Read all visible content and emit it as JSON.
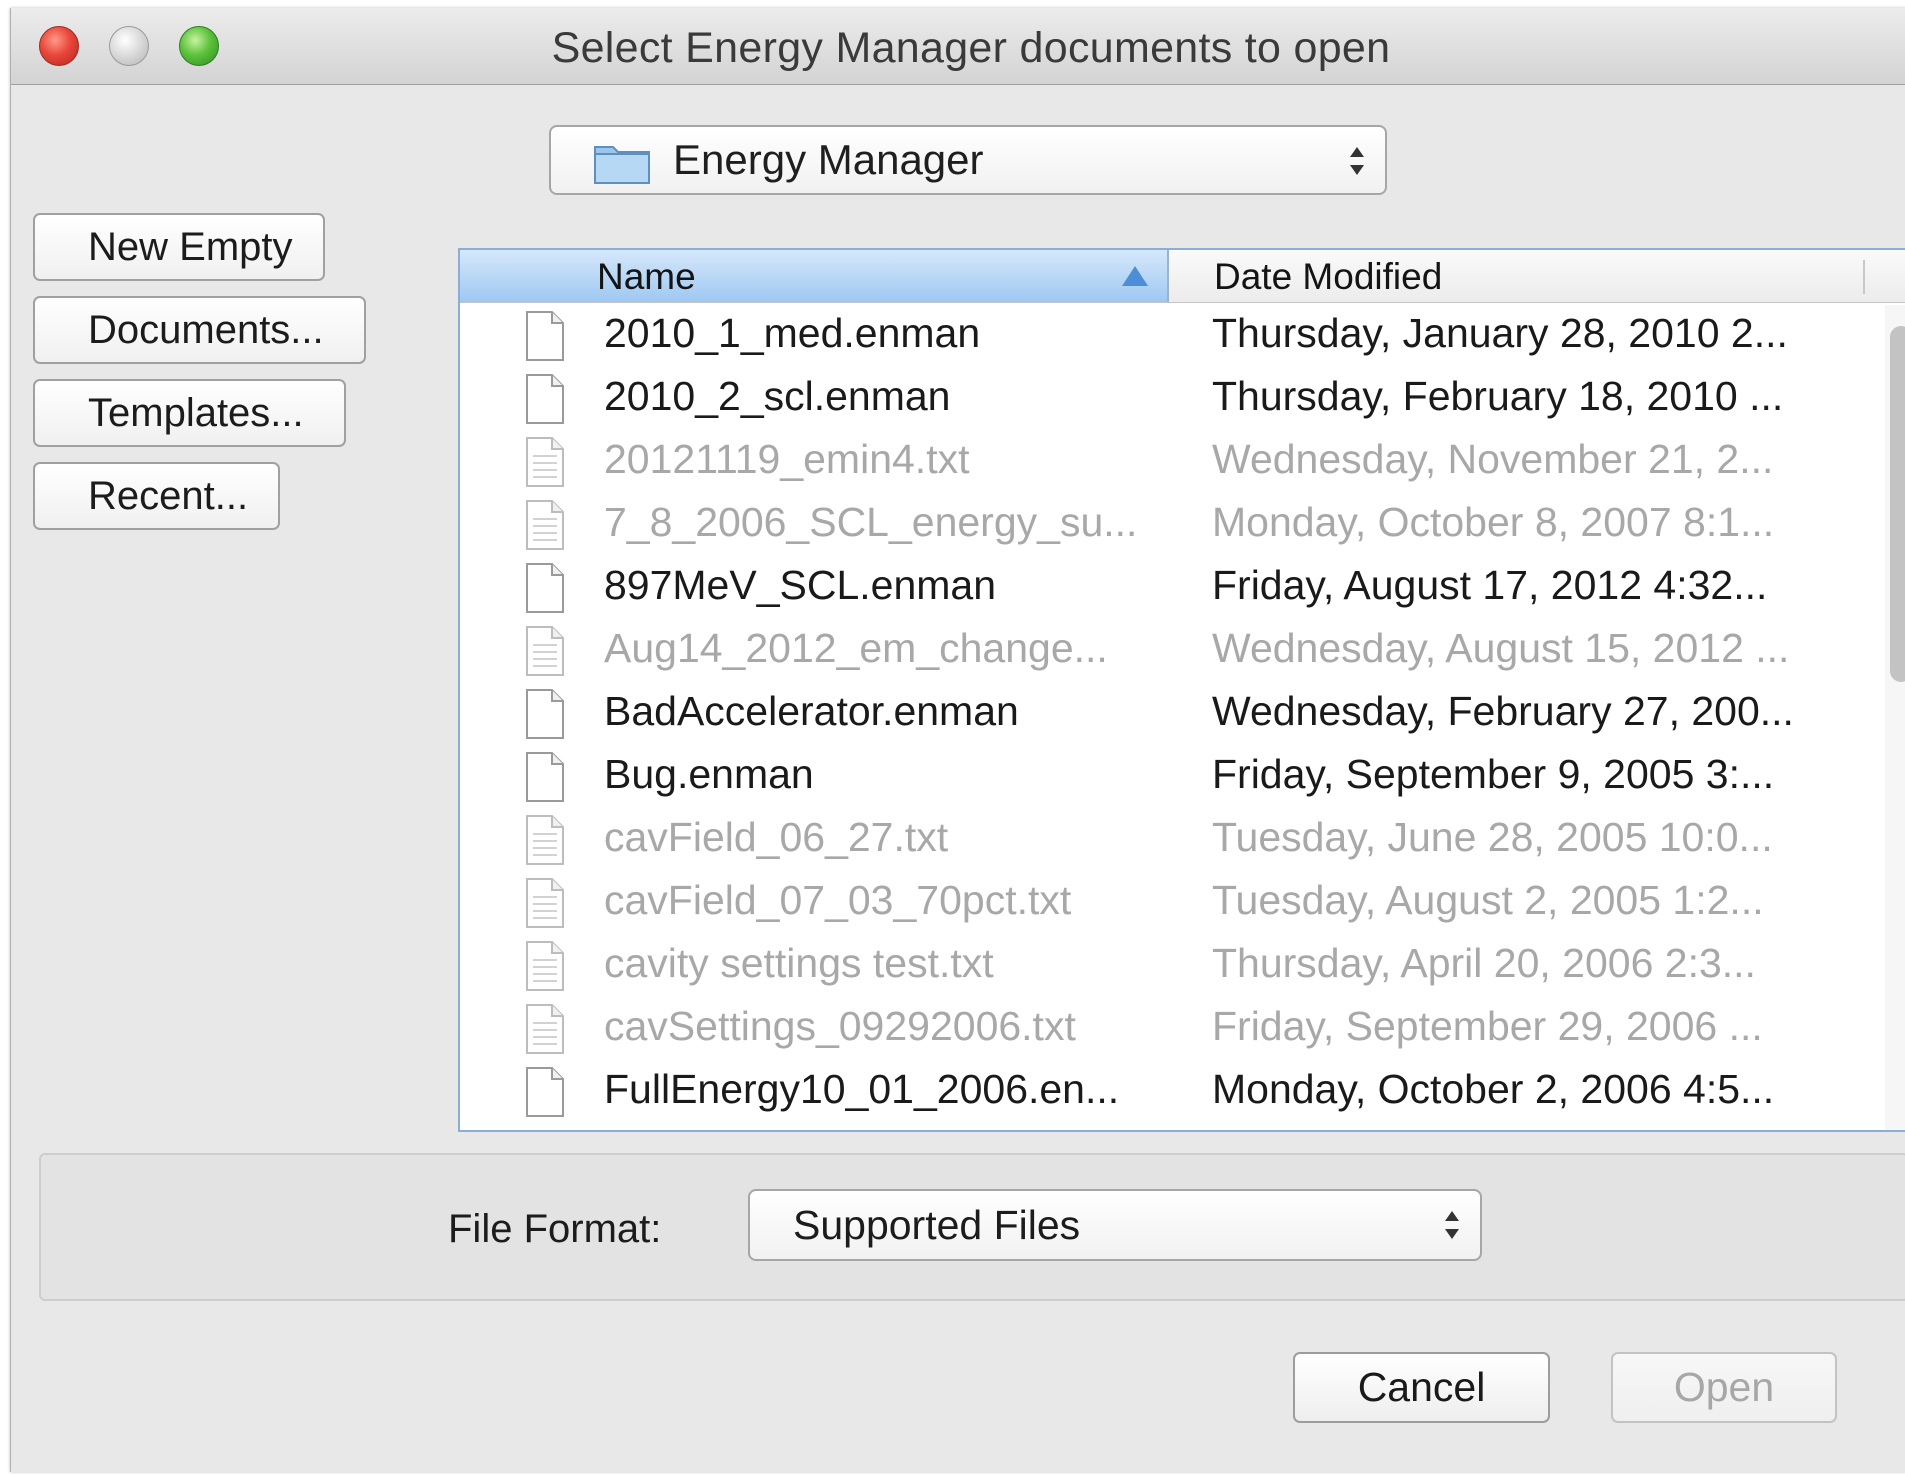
{
  "window": {
    "title": "Select Energy Manager documents to open"
  },
  "location": {
    "value": "Energy Manager",
    "icon": "folder-icon"
  },
  "sidebar": {
    "buttons": [
      {
        "label": "New Empty"
      },
      {
        "label": "Documents..."
      },
      {
        "label": "Templates..."
      },
      {
        "label": "Recent..."
      }
    ]
  },
  "table": {
    "columns": {
      "name": "Name",
      "date": "Date Modified"
    },
    "sort": {
      "column": "Name",
      "direction": "ascending"
    },
    "rows": [
      {
        "name": "2010_1_med.enman",
        "date": "Thursday, January 28, 2010 2...",
        "enabled": true
      },
      {
        "name": "2010_2_scl.enman",
        "date": "Thursday, February 18, 2010 ...",
        "enabled": true
      },
      {
        "name": "20121119_emin4.txt",
        "date": "Wednesday, November 21, 2...",
        "enabled": false
      },
      {
        "name": "7_8_2006_SCL_energy_su...",
        "date": "Monday, October 8, 2007 8:1...",
        "enabled": false
      },
      {
        "name": "897MeV_SCL.enman",
        "date": "Friday, August 17, 2012 4:32...",
        "enabled": true
      },
      {
        "name": "Aug14_2012_em_change...",
        "date": "Wednesday, August 15, 2012 ...",
        "enabled": false
      },
      {
        "name": "BadAccelerator.enman",
        "date": "Wednesday, February 27, 200...",
        "enabled": true
      },
      {
        "name": "Bug.enman",
        "date": "Friday, September 9, 2005 3:...",
        "enabled": true
      },
      {
        "name": "cavField_06_27.txt",
        "date": "Tuesday, June 28, 2005 10:0...",
        "enabled": false
      },
      {
        "name": "cavField_07_03_70pct.txt",
        "date": "Tuesday, August 2, 2005 1:2...",
        "enabled": false
      },
      {
        "name": "cavity settings test.txt",
        "date": "Thursday, April 20, 2006 2:3...",
        "enabled": false
      },
      {
        "name": "cavSettings_09292006.txt",
        "date": "Friday, September 29, 2006 ...",
        "enabled": false
      },
      {
        "name": "FullEnergy10_01_2006.en...",
        "date": "Monday, October 2, 2006 4:5...",
        "enabled": true
      }
    ]
  },
  "format": {
    "label": "File Format:",
    "value": "Supported Files"
  },
  "actions": {
    "cancel_label": "Cancel",
    "open_label": "Open"
  }
}
